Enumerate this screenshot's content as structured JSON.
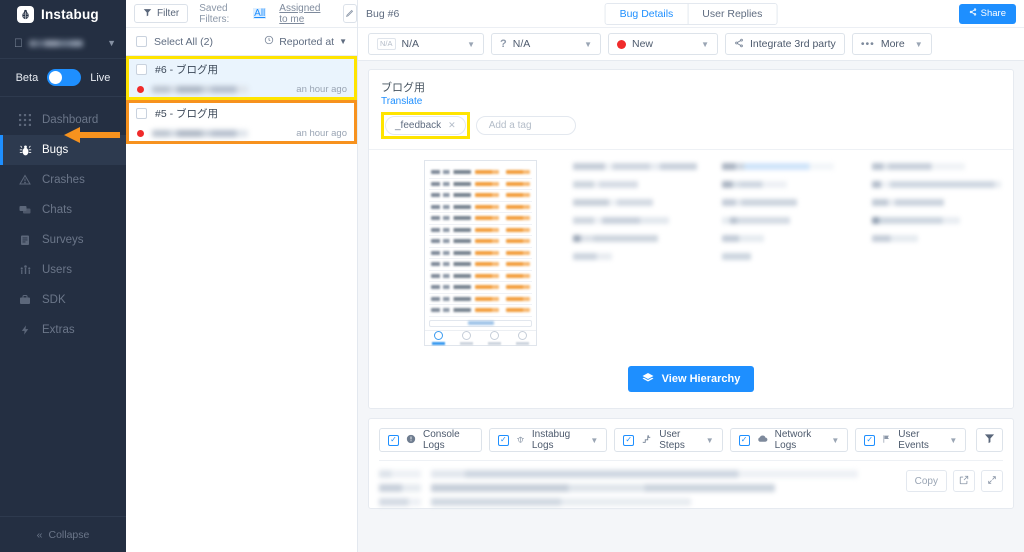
{
  "brand": {
    "name": "Instabug",
    "logo_icon": "ladybug-icon"
  },
  "sidebar": {
    "app_selector": {
      "platform_icon": "apple-icon",
      "app_name_blurred": true,
      "chevron_icon": "chevron-down-icon"
    },
    "env_toggle": {
      "left_label": "Beta",
      "right_label": "Live",
      "state": "Beta",
      "accent": "#1e8fff"
    },
    "items": [
      {
        "label": "Dashboard",
        "icon": "grid-icon",
        "active": false
      },
      {
        "label": "Bugs",
        "icon": "bug-icon",
        "active": true
      },
      {
        "label": "Crashes",
        "icon": "warning-triangle-icon",
        "active": false
      },
      {
        "label": "Chats",
        "icon": "chat-bubble-icon",
        "active": false
      },
      {
        "label": "Surveys",
        "icon": "clipboard-icon",
        "active": false
      },
      {
        "label": "Users",
        "icon": "users-icon",
        "active": false
      },
      {
        "label": "SDK",
        "icon": "briefcase-icon",
        "active": false
      },
      {
        "label": "Extras",
        "icon": "lightning-icon",
        "active": false
      }
    ],
    "collapse": {
      "label": "Collapse",
      "icon": "double-chevron-left-icon"
    }
  },
  "annotation": {
    "arrow_color": "#f7921e",
    "points_to": "Bugs",
    "highlight_yellow": "#ffe400",
    "highlight_orange": "#f7921e"
  },
  "toolbar": {
    "filter_label": "Filter",
    "filter_icon": "funnel-icon",
    "saved_filters_label": "Saved Filters:",
    "saved_all": "All",
    "saved_assigned": "Assigned to me",
    "edit_icon": "pencil-icon"
  },
  "list": {
    "select_all_label": "Select All (2)",
    "sort_label": "Reported at",
    "sort_icon": "clock-icon",
    "sort_caret": "chevron-down-icon",
    "rows": [
      {
        "title": "#6 - ブログ用",
        "time": "an hour ago",
        "status_color": "#f02b2b",
        "selected": true,
        "highlight": "yellow"
      },
      {
        "title": "#5 - ブログ用",
        "time": "an hour ago",
        "status_color": "#f02b2b",
        "selected": false,
        "highlight": "orange"
      }
    ]
  },
  "detail": {
    "bug_number": "Bug #6",
    "keyboard_icon": "keyboard-icon",
    "tabs": [
      {
        "label": "Bug Details",
        "active": true
      },
      {
        "label": "User Replies",
        "active": false
      }
    ],
    "share": {
      "label": "Share",
      "icon": "share-icon"
    },
    "actions": [
      {
        "label": "N/A",
        "badge": "N/A",
        "icon": "na-badge-icon",
        "caret": true
      },
      {
        "label": "N/A",
        "icon": "question-mark-icon",
        "caret": true
      },
      {
        "label": "New",
        "icon": "status-dot-icon",
        "color": "#f02b2b",
        "caret": true
      },
      {
        "label": "Integrate 3rd party",
        "icon": "share-nodes-icon",
        "caret": false
      },
      {
        "label": "More",
        "icon": "ellipsis-icon",
        "caret": true
      }
    ],
    "report": {
      "title": "ブログ用",
      "translate_label": "Translate",
      "tags": [
        {
          "label": "_feedback",
          "remove_icon": "close-icon"
        }
      ],
      "add_tag_placeholder": "Add a tag"
    },
    "view_hierarchy": {
      "label": "View Hierarchy",
      "icon": "layers-icon"
    },
    "logs": {
      "filters": [
        {
          "label": "Console Logs",
          "icon": "info-circle-icon",
          "checked": true,
          "caret": false
        },
        {
          "label": "Instabug Logs",
          "icon": "instabug-icon",
          "checked": true,
          "caret": true
        },
        {
          "label": "User Steps",
          "icon": "steps-icon",
          "checked": true,
          "caret": true
        },
        {
          "label": "Network Logs",
          "icon": "cloud-icon",
          "checked": true,
          "caret": true
        },
        {
          "label": "User Events",
          "icon": "flag-icon",
          "checked": true,
          "caret": true
        }
      ],
      "filter_icon": "funnel-icon",
      "copy_label": "Copy",
      "open_icon": "external-link-icon",
      "expand_icon": "expand-arrows-icon"
    }
  }
}
